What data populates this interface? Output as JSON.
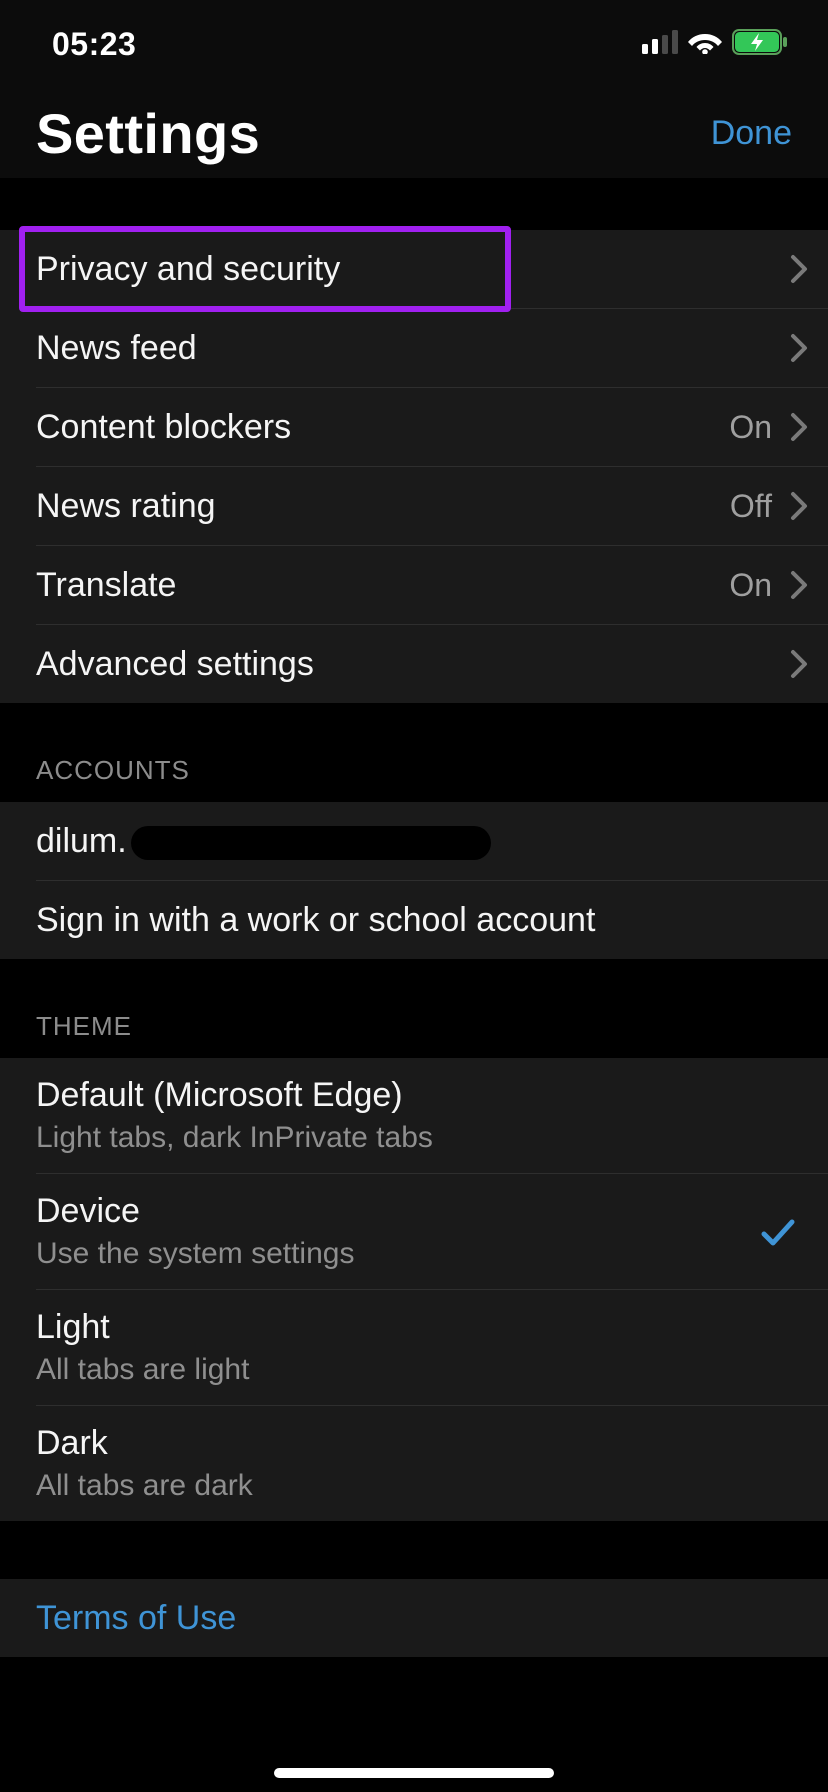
{
  "status": {
    "time": "05:23"
  },
  "header": {
    "title": "Settings",
    "done": "Done"
  },
  "general": {
    "privacy": {
      "label": "Privacy and security"
    },
    "newsfeed": {
      "label": "News feed"
    },
    "blockers": {
      "label": "Content blockers",
      "value": "On"
    },
    "rating": {
      "label": "News rating",
      "value": "Off"
    },
    "translate": {
      "label": "Translate",
      "value": "On"
    },
    "advanced": {
      "label": "Advanced settings"
    }
  },
  "accounts": {
    "header": "ACCOUNTS",
    "user_prefix": "dilum.",
    "work_school": "Sign in with a work or school account"
  },
  "theme": {
    "header": "THEME",
    "default": {
      "title": "Default (Microsoft Edge)",
      "sub": "Light tabs, dark InPrivate tabs"
    },
    "device": {
      "title": "Device",
      "sub": "Use the system settings",
      "selected": true
    },
    "light": {
      "title": "Light",
      "sub": "All tabs are light"
    },
    "dark": {
      "title": "Dark",
      "sub": "All tabs are dark"
    }
  },
  "footer": {
    "terms": "Terms of Use"
  }
}
